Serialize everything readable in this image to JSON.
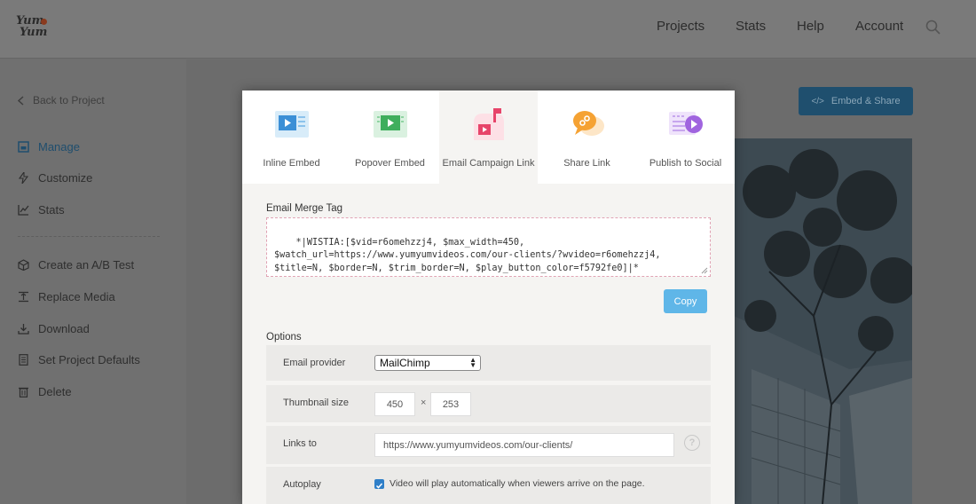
{
  "logo": {
    "line1": "Yum",
    "line2": "Yum"
  },
  "topnav": {
    "items": [
      "Projects",
      "Stats",
      "Help",
      "Account"
    ]
  },
  "sidebar": {
    "back_label": "Back to Project",
    "items": [
      {
        "label": "Manage",
        "icon": "manage-icon",
        "active": true
      },
      {
        "label": "Customize",
        "icon": "bolt-icon"
      },
      {
        "label": "Stats",
        "icon": "chart-icon"
      },
      {
        "label": "Create an A/B Test",
        "icon": "cube-icon"
      },
      {
        "label": "Replace Media",
        "icon": "replace-icon"
      },
      {
        "label": "Download",
        "icon": "download-icon"
      },
      {
        "label": "Set Project Defaults",
        "icon": "document-icon"
      },
      {
        "label": "Delete",
        "icon": "trash-icon"
      }
    ]
  },
  "header": {
    "embed_share_label": "Embed & Share"
  },
  "modal": {
    "tabs": [
      {
        "label": "Inline Embed",
        "icon": "inline-embed-icon"
      },
      {
        "label": "Popover Embed",
        "icon": "popover-embed-icon"
      },
      {
        "label": "Email Campaign Link",
        "icon": "email-campaign-icon",
        "active": true
      },
      {
        "label": "Share Link",
        "icon": "share-link-icon"
      },
      {
        "label": "Publish to Social",
        "icon": "publish-social-icon"
      }
    ],
    "merge_tag_label": "Email Merge Tag",
    "merge_tag_value": "*|WISTIA:[$vid=r6omehzzj4, $max_width=450,\n$watch_url=https://www.yumyumvideos.com/our-clients/?wvideo=r6omehzzj4,\n$title=N, $border=N, $trim_border=N, $play_button_color=f5792fe0]|*",
    "copy_label": "Copy",
    "options_label": "Options",
    "options": {
      "email_provider": {
        "label": "Email provider",
        "value": "MailChimp"
      },
      "thumbnail_size": {
        "label": "Thumbnail size",
        "width": "450",
        "height": "253",
        "separator": "×"
      },
      "links_to": {
        "label": "Links to",
        "value": "https://www.yumyumvideos.com/our-clients/",
        "help": "?"
      },
      "autoplay": {
        "label": "Autoplay",
        "checked": true,
        "text": "Video will play automatically when viewers arrive on the page."
      }
    }
  },
  "colors": {
    "accent": "#5fb6e8",
    "checkbox": "#2f7fc8",
    "brand_button": "#1f4f6e"
  }
}
